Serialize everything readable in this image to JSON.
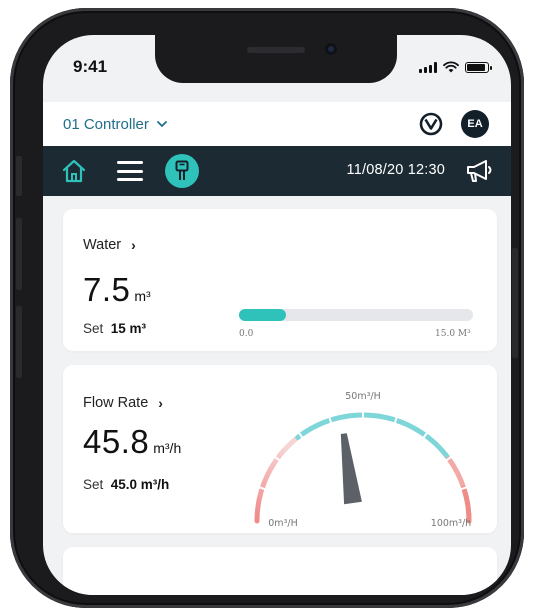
{
  "status_bar": {
    "time": "9:41"
  },
  "header": {
    "controller_label": "01 Controller",
    "avatar_initials": "EA"
  },
  "navbar": {
    "datetime": "11/08/20  12:30",
    "accent_color": "#2ec2bb",
    "bar_color": "#1c2a33"
  },
  "water": {
    "title": "Water",
    "value": "7.5",
    "unit": "m³",
    "set_label": "Set",
    "set_value": "15 m³",
    "progress_fraction": 0.2,
    "progress_min": "0.0",
    "progress_max": "15.0 M³"
  },
  "flow": {
    "title": "Flow Rate",
    "value": "45.8",
    "unit": "m³/h",
    "set_label": "Set",
    "set_value": "45.0 m³/h",
    "gauge_value": 45.8,
    "gauge_min_value": 0,
    "gauge_max_value": 100,
    "gauge_min_label": "0m³/H",
    "gauge_mid_label": "50m³/H",
    "gauge_max_label": "100m³/h"
  },
  "icons": {
    "home": "home-icon",
    "menu": "hamburger-menu-icon",
    "device": "controller-device-icon",
    "announce": "megaphone-icon",
    "logo": "brand-logo-icon"
  }
}
